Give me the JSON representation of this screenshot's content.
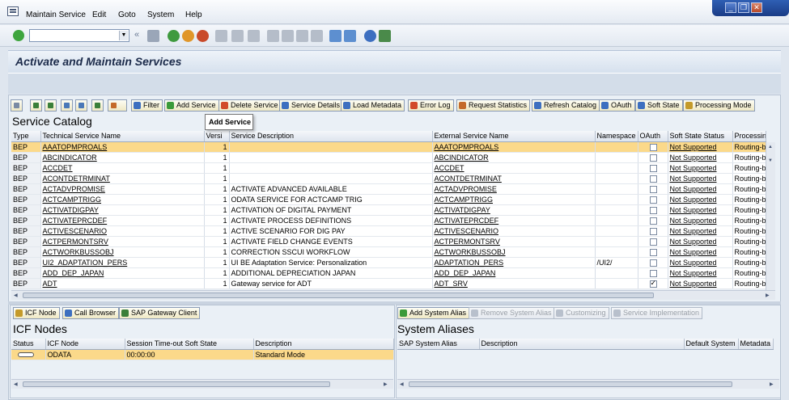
{
  "menu": {
    "items": [
      "Maintain Service",
      "Edit",
      "Goto",
      "System",
      "Help"
    ]
  },
  "window_controls": {
    "minimize": "_",
    "restore": "❐",
    "close": "✕"
  },
  "toolbar": {
    "command_field_value": "",
    "back_glyph": "«"
  },
  "page": {
    "title": "Activate and Maintain Services"
  },
  "service_catalog": {
    "toolbar": {
      "filter": "Filter",
      "add_service": "Add Service",
      "delete_service": "Delete Service",
      "service_details": "Service Details",
      "load_metadata": "Load Metadata",
      "error_log": "Error Log",
      "request_statistics": "Request Statistics",
      "refresh_catalog": "Refresh Catalog",
      "oauth": "OAuth",
      "soft_state": "Soft State",
      "processing_mode": "Processing Mode"
    },
    "tooltip": "Add Service",
    "title": "Service Catalog",
    "columns": [
      "Type",
      "Technical Service Name",
      "Versi",
      "Service Description",
      "External Service Name",
      "Namespace",
      "OAuth",
      "Soft State Status",
      "Processing"
    ],
    "rows": [
      {
        "type": "BEP",
        "tech": "AAATOPMPROALS",
        "ver": "1",
        "desc": "",
        "ext": "AAATOPMPROALS",
        "ns": "",
        "oauth": false,
        "soft": "Not Supported",
        "proc": "Routing-b",
        "selected": true
      },
      {
        "type": "BEP",
        "tech": "ABCINDICATOR",
        "ver": "1",
        "desc": "",
        "ext": "ABCINDICATOR",
        "ns": "",
        "oauth": false,
        "soft": "Not Supported",
        "proc": "Routing-b"
      },
      {
        "type": "BEP",
        "tech": "ACCDET",
        "ver": "1",
        "desc": "",
        "ext": "ACCDET",
        "ns": "",
        "oauth": false,
        "soft": "Not Supported",
        "proc": "Routing-b"
      },
      {
        "type": "BEP",
        "tech": "ACONTDETRMINAT",
        "ver": "1",
        "desc": "",
        "ext": "ACONTDETRMINAT",
        "ns": "",
        "oauth": false,
        "soft": "Not Supported",
        "proc": "Routing-b"
      },
      {
        "type": "BEP",
        "tech": "ACTADVPROMISE",
        "ver": "1",
        "desc": "ACTIVATE ADVANCED AVAILABLE",
        "ext": "ACTADVPROMISE",
        "ns": "",
        "oauth": false,
        "soft": "Not Supported",
        "proc": "Routing-b"
      },
      {
        "type": "BEP",
        "tech": "ACTCAMPTRIGG",
        "ver": "1",
        "desc": "ODATA SERVICE FOR ACTCAMP TRIG",
        "ext": "ACTCAMPTRIGG",
        "ns": "",
        "oauth": false,
        "soft": "Not Supported",
        "proc": "Routing-b"
      },
      {
        "type": "BEP",
        "tech": "ACTIVATDIGPAY",
        "ver": "1",
        "desc": "ACTIVATION OF DIGITAL PAYMENT",
        "ext": "ACTIVATDIGPAY",
        "ns": "",
        "oauth": false,
        "soft": "Not Supported",
        "proc": "Routing-b"
      },
      {
        "type": "BEP",
        "tech": "ACTIVATEPRCDEF",
        "ver": "1",
        "desc": "ACTIVATE PROCESS DEFINITIONS",
        "ext": "ACTIVATEPRCDEF",
        "ns": "",
        "oauth": false,
        "soft": "Not Supported",
        "proc": "Routing-b"
      },
      {
        "type": "BEP",
        "tech": "ACTIVESCENARIO",
        "ver": "1",
        "desc": "ACTIVE SCENARIO FOR DIG PAY",
        "ext": "ACTIVESCENARIO",
        "ns": "",
        "oauth": false,
        "soft": "Not Supported",
        "proc": "Routing-b"
      },
      {
        "type": "BEP",
        "tech": "ACTPERMONTSRV",
        "ver": "1",
        "desc": "ACTIVATE FIELD CHANGE EVENTS",
        "ext": "ACTPERMONTSRV",
        "ns": "",
        "oauth": false,
        "soft": "Not Supported",
        "proc": "Routing-b"
      },
      {
        "type": "BEP",
        "tech": "ACTWORKBUSSOBJ",
        "ver": "1",
        "desc": "CORRECTION SSCUI WORKFLOW",
        "ext": "ACTWORKBUSSOBJ",
        "ns": "",
        "oauth": false,
        "soft": "Not Supported",
        "proc": "Routing-b"
      },
      {
        "type": "BEP",
        "tech": "UI2_ADAPTATION_PERS",
        "ver": "1",
        "desc": "UI BE Adaptation Service: Personalization",
        "ext": "ADAPTATION_PERS",
        "ns": "/UI2/",
        "oauth": false,
        "soft": "Not Supported",
        "proc": "Routing-b"
      },
      {
        "type": "BEP",
        "tech": "ADD_DEP_JAPAN",
        "ver": "1",
        "desc": "ADDITIONAL DEPRECIATION JAPAN",
        "ext": "ADD_DEP_JAPAN",
        "ns": "",
        "oauth": false,
        "soft": "Not Supported",
        "proc": "Routing-b"
      },
      {
        "type": "BEP",
        "tech": "ADT",
        "ver": "1",
        "desc": "Gateway service for ADT",
        "ext": "ADT_SRV",
        "ns": "",
        "oauth": true,
        "soft": "Not Supported",
        "proc": "Routing-b"
      }
    ]
  },
  "icf_nodes": {
    "toolbar": {
      "icf_node": "ICF Node",
      "call_browser": "Call Browser",
      "sap_gateway_client": "SAP Gateway Client"
    },
    "title": "ICF Nodes",
    "columns": [
      "Status",
      "ICF Node",
      "Session Time-out Soft State",
      "Description"
    ],
    "rows": [
      {
        "node": "ODATA",
        "timeout": "00:00:00",
        "desc": "Standard Mode"
      }
    ]
  },
  "system_aliases": {
    "toolbar": {
      "add_system_alias": "Add System Alias",
      "remove_system_alias": "Remove System Alias",
      "customizing": "Customizing",
      "service_implementation": "Service Implementation"
    },
    "title": "System Aliases",
    "columns": [
      "SAP System Alias",
      "Description",
      "Default System",
      "Metadata"
    ]
  }
}
